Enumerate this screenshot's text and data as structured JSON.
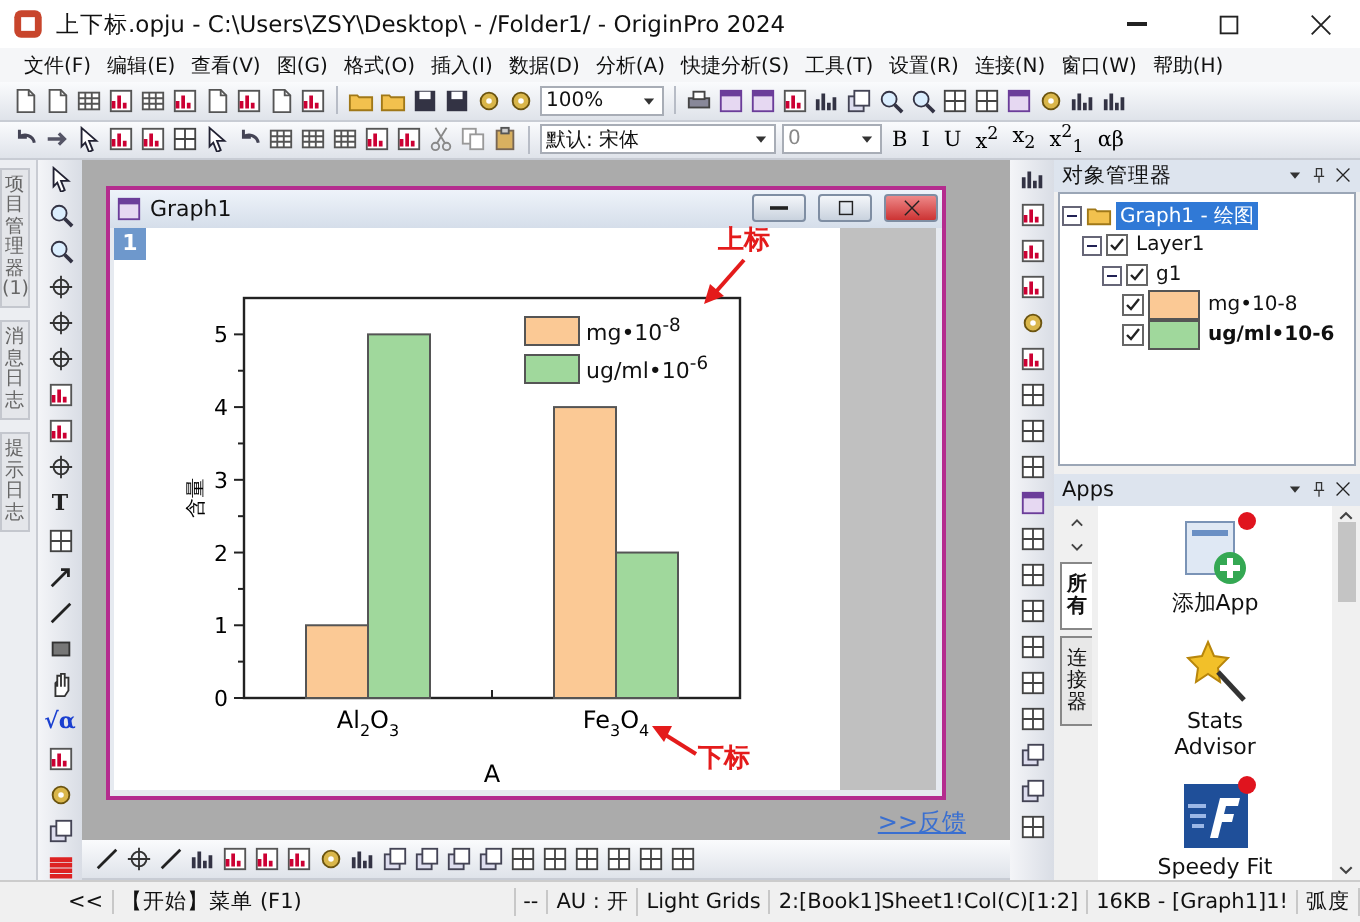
{
  "window": {
    "title": "上下标.opju - C:\\Users\\ZSY\\Desktop\\ - /Folder1/ - OriginPro 2024"
  },
  "menu": [
    "文件(F)",
    "编辑(E)",
    "查看(V)",
    "图(G)",
    "格式(O)",
    "插入(I)",
    "数据(D)",
    "分析(A)",
    "快捷分析(S)",
    "工具(T)",
    "设置(R)",
    "连接(N)",
    "窗口(W)",
    "帮助(H)"
  ],
  "standard_toolbar": {
    "zoom": "100%"
  },
  "format_toolbar": {
    "font": "默认: 宋体",
    "size": "0",
    "buttons": [
      "B",
      "I",
      "U",
      "x$^{2}$",
      "x$_{2}$",
      "x$^{2}$$_{1}$",
      "αβ"
    ]
  },
  "left_tabs": [
    {
      "label": "项目管理器 (1)"
    },
    {
      "label": "消息日志"
    },
    {
      "label": "提示日志"
    }
  ],
  "tools": {
    "text_tool": "T",
    "equation_tool": "√α"
  },
  "graph_window": {
    "title": "Graph1",
    "layer": "1",
    "chart_data": {
      "type": "bar",
      "xlabel": "A",
      "ylabel": "含量",
      "categories": [
        "Al$_{2}$O$_{3}$",
        "Fe$_{3}$O$_{4}$"
      ],
      "series": [
        {
          "name": "mg•10$^{-8}$",
          "color": "#fbc995",
          "values": [
            1,
            4
          ]
        },
        {
          "name": "ug/ml•10$^{-6}$",
          "color": "#a0d89c",
          "values": [
            5,
            2
          ]
        }
      ],
      "ylim": [
        0,
        5.5
      ],
      "yticks": [
        0,
        1,
        2,
        3,
        4,
        5
      ],
      "legend": true
    },
    "annotations": [
      {
        "text": "上标",
        "kind": "arrow-down-left"
      },
      {
        "text": "下标",
        "kind": "arrow-up-left"
      }
    ]
  },
  "feedback_link": ">>反馈",
  "object_manager": {
    "title": "对象管理器",
    "tree": [
      {
        "label": "Graph1 - 绘图",
        "kind": "graph",
        "selected": true,
        "expanded": true,
        "children": [
          {
            "label": "Layer1",
            "checked": true,
            "selected": false,
            "expanded": true,
            "children": [
              {
                "label": "g1",
                "checked": true,
                "selected": false,
                "expanded": true,
                "children": [
                  {
                    "label": "mg•10-8",
                    "kind": "plot",
                    "checked": true,
                    "selected": false,
                    "current": false,
                    "color": "#fbc995"
                  },
                  {
                    "label": "ug/ml•10-6",
                    "kind": "plot",
                    "checked": true,
                    "selected": false,
                    "current": true,
                    "color": "#a0d89c"
                  }
                ]
              }
            ]
          }
        ]
      }
    ]
  },
  "apps": {
    "title": "Apps",
    "tabs": [
      {
        "label": "所有",
        "selected": true
      },
      {
        "label": "连接器",
        "selected": false
      }
    ],
    "items": [
      {
        "name": "添加App",
        "kind": "add",
        "badge": true
      },
      {
        "name": "Stats Advisor",
        "kind": "wand",
        "badge": false
      },
      {
        "name": "Speedy Fit",
        "kind": "fit",
        "badge": true
      }
    ]
  },
  "status_bar": [
    "<<",
    "【开始】菜单 (F1)",
    "--",
    "AU : 开",
    "Light Grids",
    "2:[Book1]Sheet1!Col(C)[1:2]",
    "16KB - [Graph1]1!",
    "弧度"
  ]
}
